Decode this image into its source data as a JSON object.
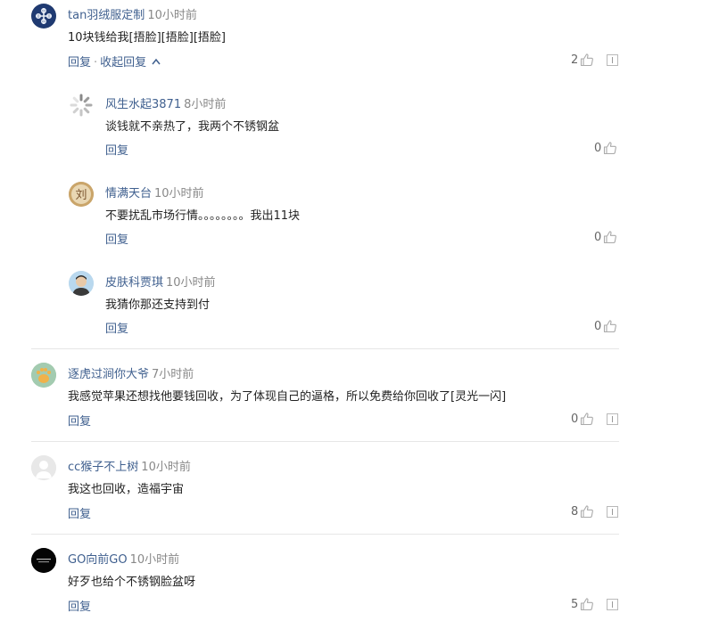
{
  "comments": [
    {
      "user": "tan羽绒服定制",
      "time": "10小时前",
      "text": "10块钱给我[捂脸][捂脸][捂脸]",
      "reply": "回复",
      "collapse": "收起回复",
      "likes": "2"
    },
    {
      "user": "风生水起3871",
      "time": "8小时前",
      "text": "谈钱就不亲热了，我两个不锈钢盆",
      "reply": "回复",
      "likes": "0"
    },
    {
      "user": "情满天台",
      "time": "10小时前",
      "text": "不要扰乱市场行情。。。。。。。。我出11块",
      "reply": "回复",
      "likes": "0",
      "avatar_char": "刘"
    },
    {
      "user": "皮肤科贾琪",
      "time": "10小时前",
      "text": "我猜你那还支持到付",
      "reply": "回复",
      "likes": "0"
    },
    {
      "user": "逐虎过涧你大爷",
      "time": "7小时前",
      "text": "我感觉苹果还想找他要钱回收，为了体现自己的逼格，所以免费给你回收了[灵光一闪]",
      "reply": "回复",
      "likes": "0"
    },
    {
      "user": "cc猴子不上树",
      "time": "10小时前",
      "text": "我这也回收，造福宇宙",
      "reply": "回复",
      "likes": "8"
    },
    {
      "user": "GO向前GO",
      "time": "10小时前",
      "text": "好歹也给个不锈钢脸盆呀",
      "reply": "回复",
      "likes": "5"
    }
  ],
  "colors": {
    "link": "#40608f",
    "time": "#888888",
    "text": "#222222",
    "divider": "#e6e6e6"
  },
  "icons": {
    "like": "thumbs-up-icon",
    "report": "report-icon"
  }
}
